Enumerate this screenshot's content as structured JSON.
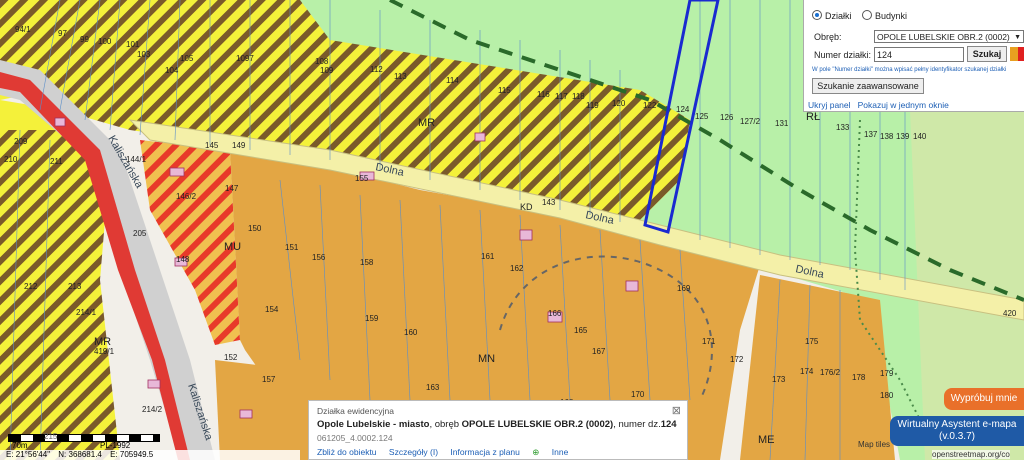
{
  "search_panel": {
    "radio_parcels": "Działki",
    "radio_buildings": "Budynki",
    "precinct_label": "Obręb:",
    "precinct_value": "OPOLE LUBELSKIE OBR.2 (0002)",
    "parcel_label": "Numer działki:",
    "parcel_value": "124",
    "search_button": "Szukaj",
    "hint": "W pole \"Numer działki\" można wpisać pełny identyfikator szukanej działki",
    "advanced_button": "Szukanie zaawansowane",
    "hide_panel": "Ukryj panel",
    "show_in_window": "Pokazuj w jednym oknie"
  },
  "popup": {
    "title": "Działka ewidencyjna",
    "place": "Opole Lubelskie - miasto",
    "precinct_prefix": ", obręb ",
    "precinct": "OPOLE LUBELSKIE OBR.2 (0002)",
    "number_prefix": ", numer dz.",
    "number": "124",
    "identifier": "061205_4.0002.124",
    "actions": [
      "Zbliż do obiektu",
      "Szczegóły (I)",
      "Informacja z planu",
      "Inne"
    ]
  },
  "scale": {
    "left": "70m",
    "mid": "215",
    "crs": "PL-1992"
  },
  "coords": {
    "e": "E: 21°56'44\"",
    "n": "N: 368681.4",
    "e2": "E: 705949.5"
  },
  "assistant": {
    "try": "Wypróbuj mnie",
    "name": "Wirtualny Asystent e-mapa",
    "version": "(v.0.3.7)"
  },
  "attribution": {
    "tiles": "Map tiles",
    "osm": "openstreetmap.org/co"
  },
  "map": {
    "streets": [
      "Dolna",
      "Dolna",
      "Dolna",
      "Kaliszańska",
      "Kaliszańska"
    ],
    "zones": [
      "MR",
      "MR",
      "RŁ",
      "MU",
      "MN",
      "MR",
      "ME",
      "KD"
    ],
    "parcels": [
      "94/1",
      "97",
      "99",
      "100",
      "101",
      "103",
      "104",
      "105",
      "1097",
      "108",
      "109",
      "112",
      "113",
      "114",
      "115",
      "116",
      "117",
      "118",
      "119",
      "120",
      "122",
      "124",
      "125",
      "126",
      "127/2",
      "131",
      "133",
      "137",
      "138",
      "139",
      "140",
      "143",
      "144/1",
      "145",
      "146/2",
      "147",
      "148",
      "149",
      "150",
      "151",
      "152",
      "154",
      "155",
      "156",
      "157",
      "158",
      "159",
      "160",
      "161",
      "162",
      "163",
      "164",
      "165",
      "166",
      "167",
      "168",
      "169",
      "170",
      "171",
      "172",
      "173",
      "174",
      "175",
      "176/2",
      "178",
      "179",
      "180",
      "205",
      "209",
      "210",
      "211",
      "212",
      "213",
      "214/1",
      "214/2",
      "419/1",
      "420"
    ],
    "colors": {
      "residential": "#e3a644",
      "mixed": "#e84a3a",
      "agri": "#f4f13a",
      "hatch": "#7a5a2a",
      "meadow": "#b8f0a8",
      "road": "#f4f0a8",
      "highlight": "#1a2ad0"
    }
  }
}
